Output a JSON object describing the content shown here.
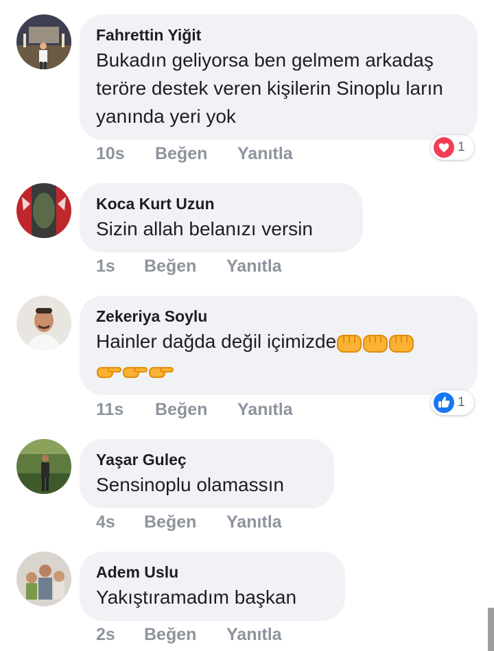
{
  "comments": [
    {
      "author": "Fahrettin Yiğit",
      "text": "Bukadın geliyorsa ben gelmem arkadaş teröre destek veren kişilerin Sinoplu ların yanında yeri yok",
      "time": "10s",
      "like": "Beğen",
      "reply": "Yanıtla",
      "reaction": {
        "type": "love",
        "count": "1"
      }
    },
    {
      "author": "Koca Kurt Uzun",
      "text": "Sizin allah belanızı versin",
      "time": "1s",
      "like": "Beğen",
      "reply": "Yanıtla"
    },
    {
      "author": "Zekeriya Soylu",
      "text": "Hainler dağda değil içimizde",
      "emojis": "fist x3, pointing-hand x3",
      "time": "11s",
      "like": "Beğen",
      "reply": "Yanıtla",
      "reaction": {
        "type": "like",
        "count": "1"
      }
    },
    {
      "author": "Yaşar Guleç",
      "text": "Sensinoplu olamassın",
      "time": "4s",
      "like": "Beğen",
      "reply": "Yanıtla"
    },
    {
      "author": "Adem Uslu",
      "text": "Yakıştıramadım başkan",
      "time": "2s",
      "like": "Beğen",
      "reply": "Yanıtla"
    }
  ],
  "colors": {
    "bubble": "#f0f2f5",
    "meta": "#8d949e",
    "love": "#f33e58",
    "like": "#1877f2"
  }
}
